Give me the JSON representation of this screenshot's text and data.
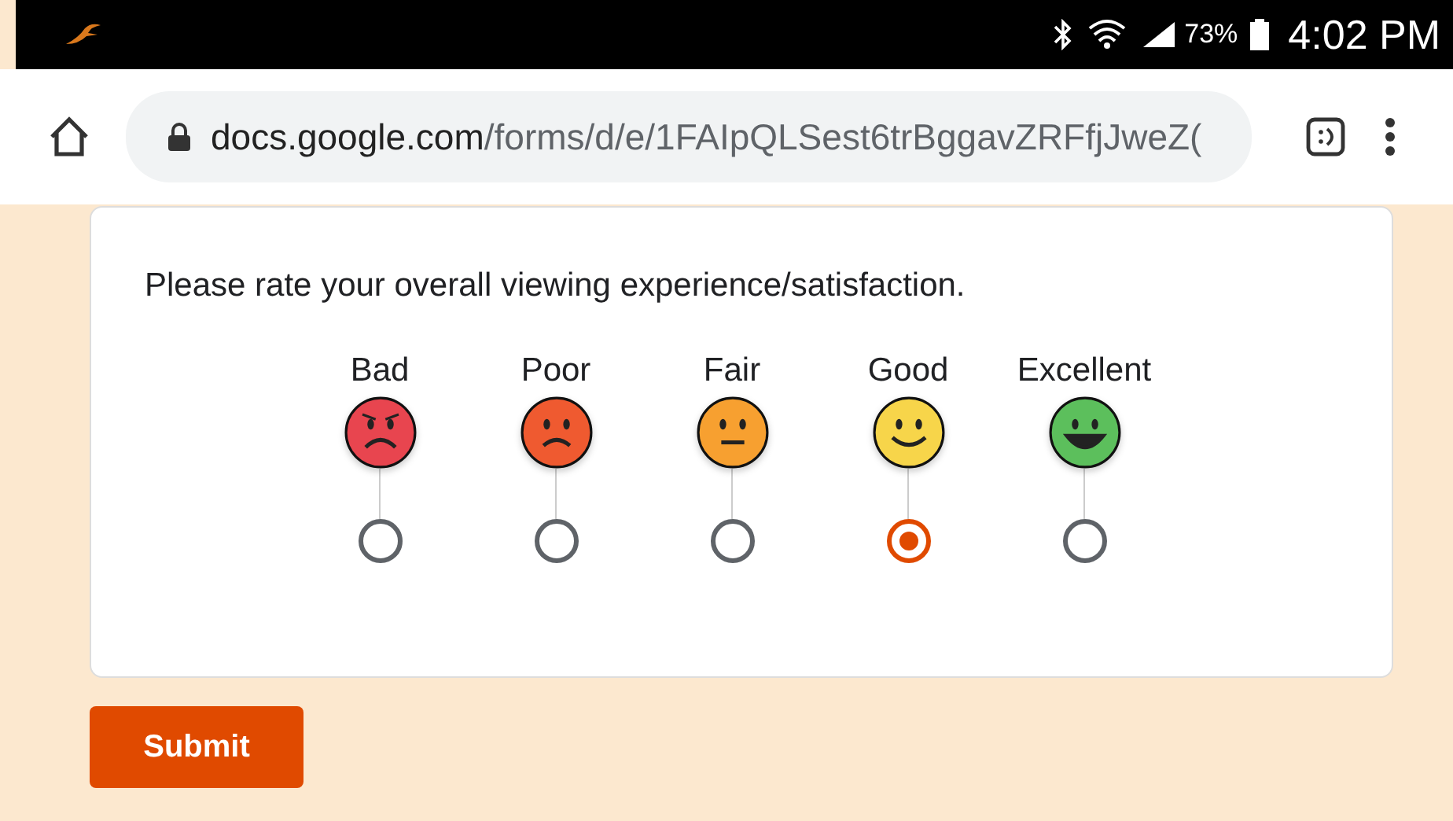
{
  "status_bar": {
    "battery": "73%",
    "time": "4:02 PM"
  },
  "address_bar": {
    "domain": "docs.google.com",
    "path": "/forms/d/e/1FAIpQLSest6trBggavZRFfjJweZ("
  },
  "question": "Please rate your overall viewing experience/satisfaction.",
  "options": [
    {
      "label": "Bad",
      "kind": "angry",
      "color": "#e8454f",
      "selected": false
    },
    {
      "label": "Poor",
      "kind": "sad",
      "color": "#ef5a30",
      "selected": false
    },
    {
      "label": "Fair",
      "kind": "neutral",
      "color": "#f7a030",
      "selected": false
    },
    {
      "label": "Good",
      "kind": "smile",
      "color": "#f7d54a",
      "selected": true
    },
    {
      "label": "Excellent",
      "kind": "grin",
      "color": "#5cbf5c",
      "selected": false
    }
  ],
  "submit": "Submit"
}
